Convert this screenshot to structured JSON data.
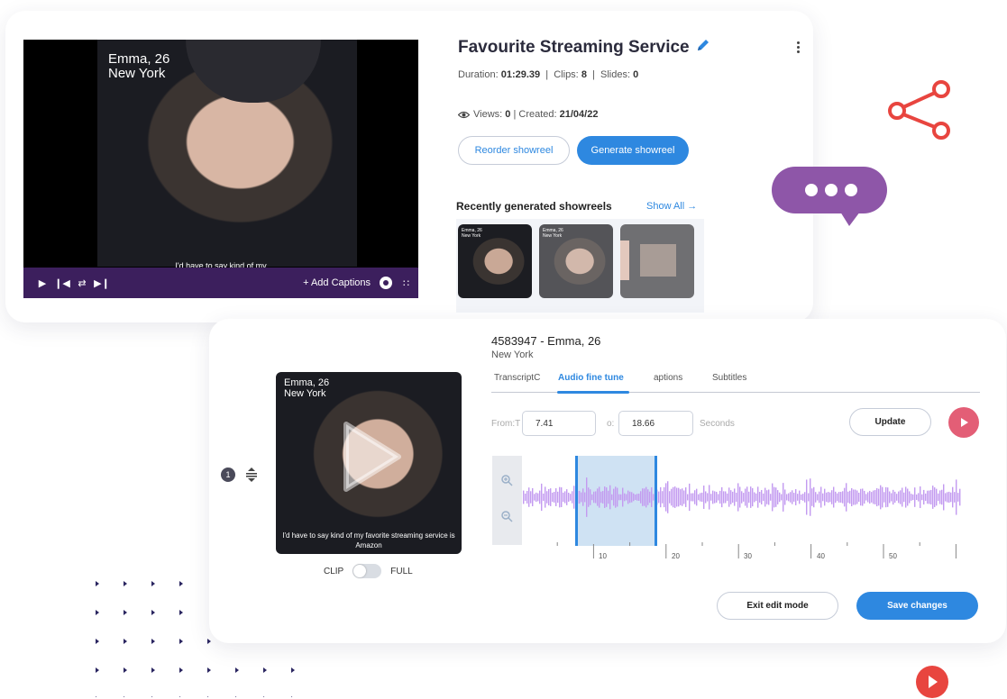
{
  "player": {
    "overlay_name": "Emma, 26",
    "overlay_location": "New York",
    "caption_fragment": "I'd have to say kind of my",
    "add_captions_label": "+ Add Captions"
  },
  "showreel": {
    "title": "Favourite Streaming Service",
    "duration_label": "Duration:",
    "duration_value": "01:29.39",
    "clips_label": "Clips:",
    "clips_value": "8",
    "slides_label": "Slides:",
    "slides_value": "0",
    "views_label": "Views:",
    "views_value": "0",
    "created_label": "Created:",
    "created_value": "21/04/22",
    "reorder_label": "Reorder showreel",
    "generate_label": "Generate showreel"
  },
  "recent": {
    "heading": "Recently generated showreels",
    "show_all": "Show All →",
    "thumbs": [
      {
        "name": "Emma, 26",
        "location": "New York"
      },
      {
        "name": "Emma, 26",
        "location": "New York"
      },
      {
        "name": "",
        "location": ""
      }
    ]
  },
  "editor": {
    "clip_number": "1",
    "clip_overlay_name": "Emma, 26",
    "clip_overlay_location": "New York",
    "clip_caption": "I'd have to say kind of my favorite streaming service is Amazon",
    "toggle_left": "CLIP",
    "toggle_right": "FULL",
    "title": "4583947 - Emma, 26",
    "subtitle": "New York",
    "tabs": [
      "TranscriptC",
      "Audio fine tune",
      "aptions",
      "Subtitles"
    ],
    "active_tab": "Audio fine tune",
    "from_label": "From:T",
    "from_value": "7.41",
    "to_label": "o:",
    "to_value": "18.66",
    "unit_label": "Seconds",
    "update_label": "Update",
    "tick_labels": [
      "10",
      "20",
      "30",
      "40",
      "50"
    ],
    "exit_label": "Exit edit mode",
    "save_label": "Save changes"
  },
  "colors": {
    "accent": "#2e88e0",
    "player_bar": "#3c1f5d",
    "waveform": "#c39af0",
    "selection": "#cfe2f3",
    "share_icon": "#e8453f",
    "chat_bubble": "#8e56a8"
  },
  "icons": {
    "title": "pencil-icon",
    "menu": "kebab-icon",
    "views": "eye-icon",
    "share": "share-icon",
    "chat": "chat-bubble-icon",
    "zoom_in": "zoom-in-icon",
    "zoom_out": "zoom-out-icon"
  }
}
